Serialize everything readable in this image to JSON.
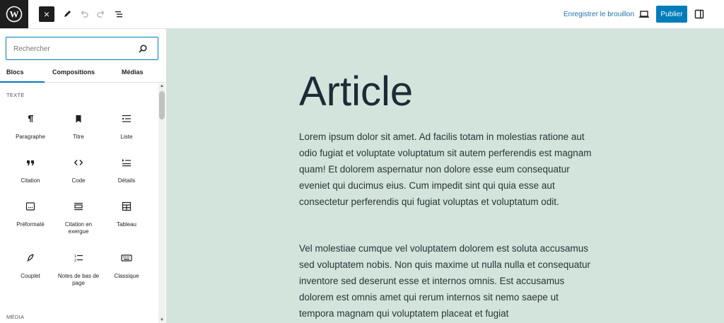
{
  "toolbar": {
    "close_icon": "×",
    "save_draft_label": "Enregistrer le brouillon",
    "publish_label": "Publier"
  },
  "inserter": {
    "search": {
      "placeholder": "Rechercher",
      "value": ""
    },
    "tabs": [
      {
        "label": "Blocs",
        "active": true
      },
      {
        "label": "Compositions",
        "active": false
      },
      {
        "label": "Médias",
        "active": false
      }
    ],
    "sections": {
      "text": "TEXTE",
      "media": "MÉDIA"
    },
    "blocks": [
      {
        "label": "Paragraphe",
        "icon": "paragraph-icon"
      },
      {
        "label": "Titre",
        "icon": "bookmark-icon"
      },
      {
        "label": "Liste",
        "icon": "list-icon"
      },
      {
        "label": "Citation",
        "icon": "quote-icon"
      },
      {
        "label": "Code",
        "icon": "code-icon"
      },
      {
        "label": "Détails",
        "icon": "details-icon"
      },
      {
        "label": "Préformaté",
        "icon": "preformatted-icon"
      },
      {
        "label": "Citation en exergue",
        "icon": "pullquote-icon"
      },
      {
        "label": "Tableau",
        "icon": "table-icon"
      },
      {
        "label": "Couplet",
        "icon": "feather-icon"
      },
      {
        "label": "Notes de bas de page",
        "icon": "footnotes-icon"
      },
      {
        "label": "Classique",
        "icon": "keyboard-icon"
      }
    ]
  },
  "post": {
    "title": "Article",
    "paragraphs": [
      "Lorem ipsum dolor sit amet. Ad facilis totam in molestias ratione aut odio fugiat et voluptate voluptatum sit autem perferendis est magnam quam! Et dolorem aspernatur non dolore esse eum consequatur eveniet qui ducimus eius. Cum impedit sint qui quia esse aut consectetur perferendis qui fugiat voluptas et voluptatum odit.",
      "Vel molestiae cumque vel voluptatem dolorem est soluta accusamus sed voluptatem nobis. Non quis maxime ut nulla nulla et consequatur inventore sed deserunt esse et internos omnis. Est accusamus dolorem est omnis amet qui rerum internos sit nemo saepe ut tempora magnam qui voluptatem placeat et fugiat"
    ]
  },
  "colors": {
    "accent": "#007cba",
    "canvas_bg": "#d2e4dc",
    "dark": "#1e1e1e"
  }
}
